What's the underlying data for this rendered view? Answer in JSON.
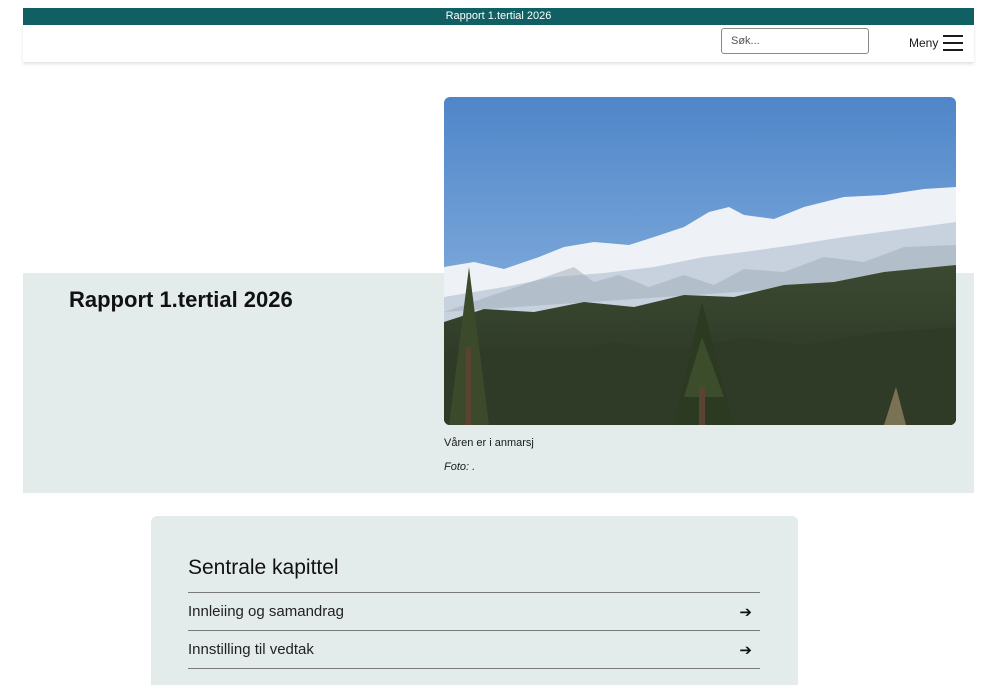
{
  "topbar": {
    "title": "Rapport 1.tertial 2026"
  },
  "header": {
    "search_placeholder": "Søk...",
    "menu_label": "Meny"
  },
  "hero": {
    "title": "Rapport 1.tertial 2026",
    "image_caption": "Våren er i anmarsj",
    "image_credit": "Foto: ."
  },
  "chapters": {
    "heading": "Sentrale kapittel",
    "items": [
      {
        "label": "Innleiing og samandrag",
        "arrow": "➔"
      },
      {
        "label": "Innstilling til vedtak",
        "arrow": "➔"
      }
    ]
  }
}
